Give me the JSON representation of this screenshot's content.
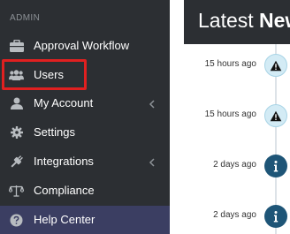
{
  "sidebar": {
    "section_label": "ADMIN",
    "items": [
      {
        "label": "Approval Workflow",
        "icon": "briefcase-icon"
      },
      {
        "label": "Users",
        "icon": "users-icon"
      },
      {
        "label": "My Account",
        "icon": "user-icon",
        "has_chevron": true
      },
      {
        "label": "Settings",
        "icon": "gear-icon"
      },
      {
        "label": "Integrations",
        "icon": "plug-icon",
        "has_chevron": true
      },
      {
        "label": "Compliance",
        "icon": "scales-icon"
      },
      {
        "label": "Help Center",
        "icon": "question-circle-icon",
        "active": true
      }
    ]
  },
  "news": {
    "title_light": "Latest ",
    "title_bold": "News",
    "events": [
      {
        "time": "15 hours ago",
        "type": "warning",
        "icon": "warning-icon"
      },
      {
        "time": "15 hours ago",
        "type": "warning",
        "icon": "warning-icon"
      },
      {
        "time": "2 days ago",
        "type": "info",
        "icon": "info-icon"
      },
      {
        "time": "2 days ago",
        "type": "info",
        "icon": "info-icon"
      }
    ]
  },
  "colors": {
    "sidebar_bg": "#2c2f33",
    "active_item_bg": "#3b3e62",
    "highlight_border": "#e02020",
    "info_marker": "#1e5577",
    "warning_marker": "#d3ebf5"
  }
}
